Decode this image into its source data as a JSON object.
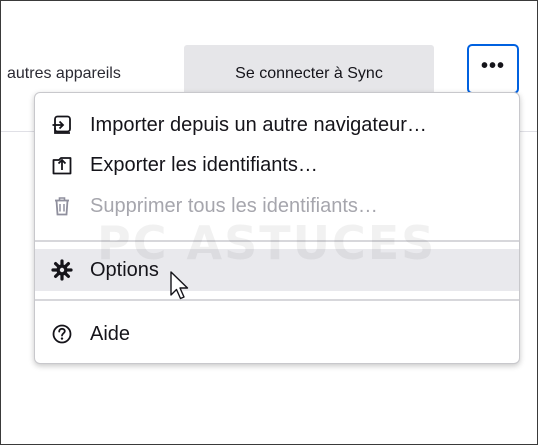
{
  "header": {
    "partial_text": "autres appareils",
    "sync_button_label": "Se connecter à Sync",
    "more_button_label": "•••"
  },
  "menu": {
    "items": [
      {
        "label": "Importer depuis un autre navigateur…",
        "icon": "import-icon",
        "disabled": false
      },
      {
        "label": "Exporter les identifiants…",
        "icon": "export-icon",
        "disabled": false
      },
      {
        "label": "Supprimer tous les identifiants…",
        "icon": "trash-icon",
        "disabled": true
      },
      {
        "label": "Options",
        "icon": "gear-icon",
        "disabled": false,
        "hovered": true
      },
      {
        "label": "Aide",
        "icon": "help-icon",
        "disabled": false
      }
    ]
  },
  "watermark": {
    "text": "PC ASTUCES"
  },
  "colors": {
    "accent": "#0061e0",
    "disabled_text": "#a6a6ad",
    "hover_bg": "#e9e9ed"
  }
}
